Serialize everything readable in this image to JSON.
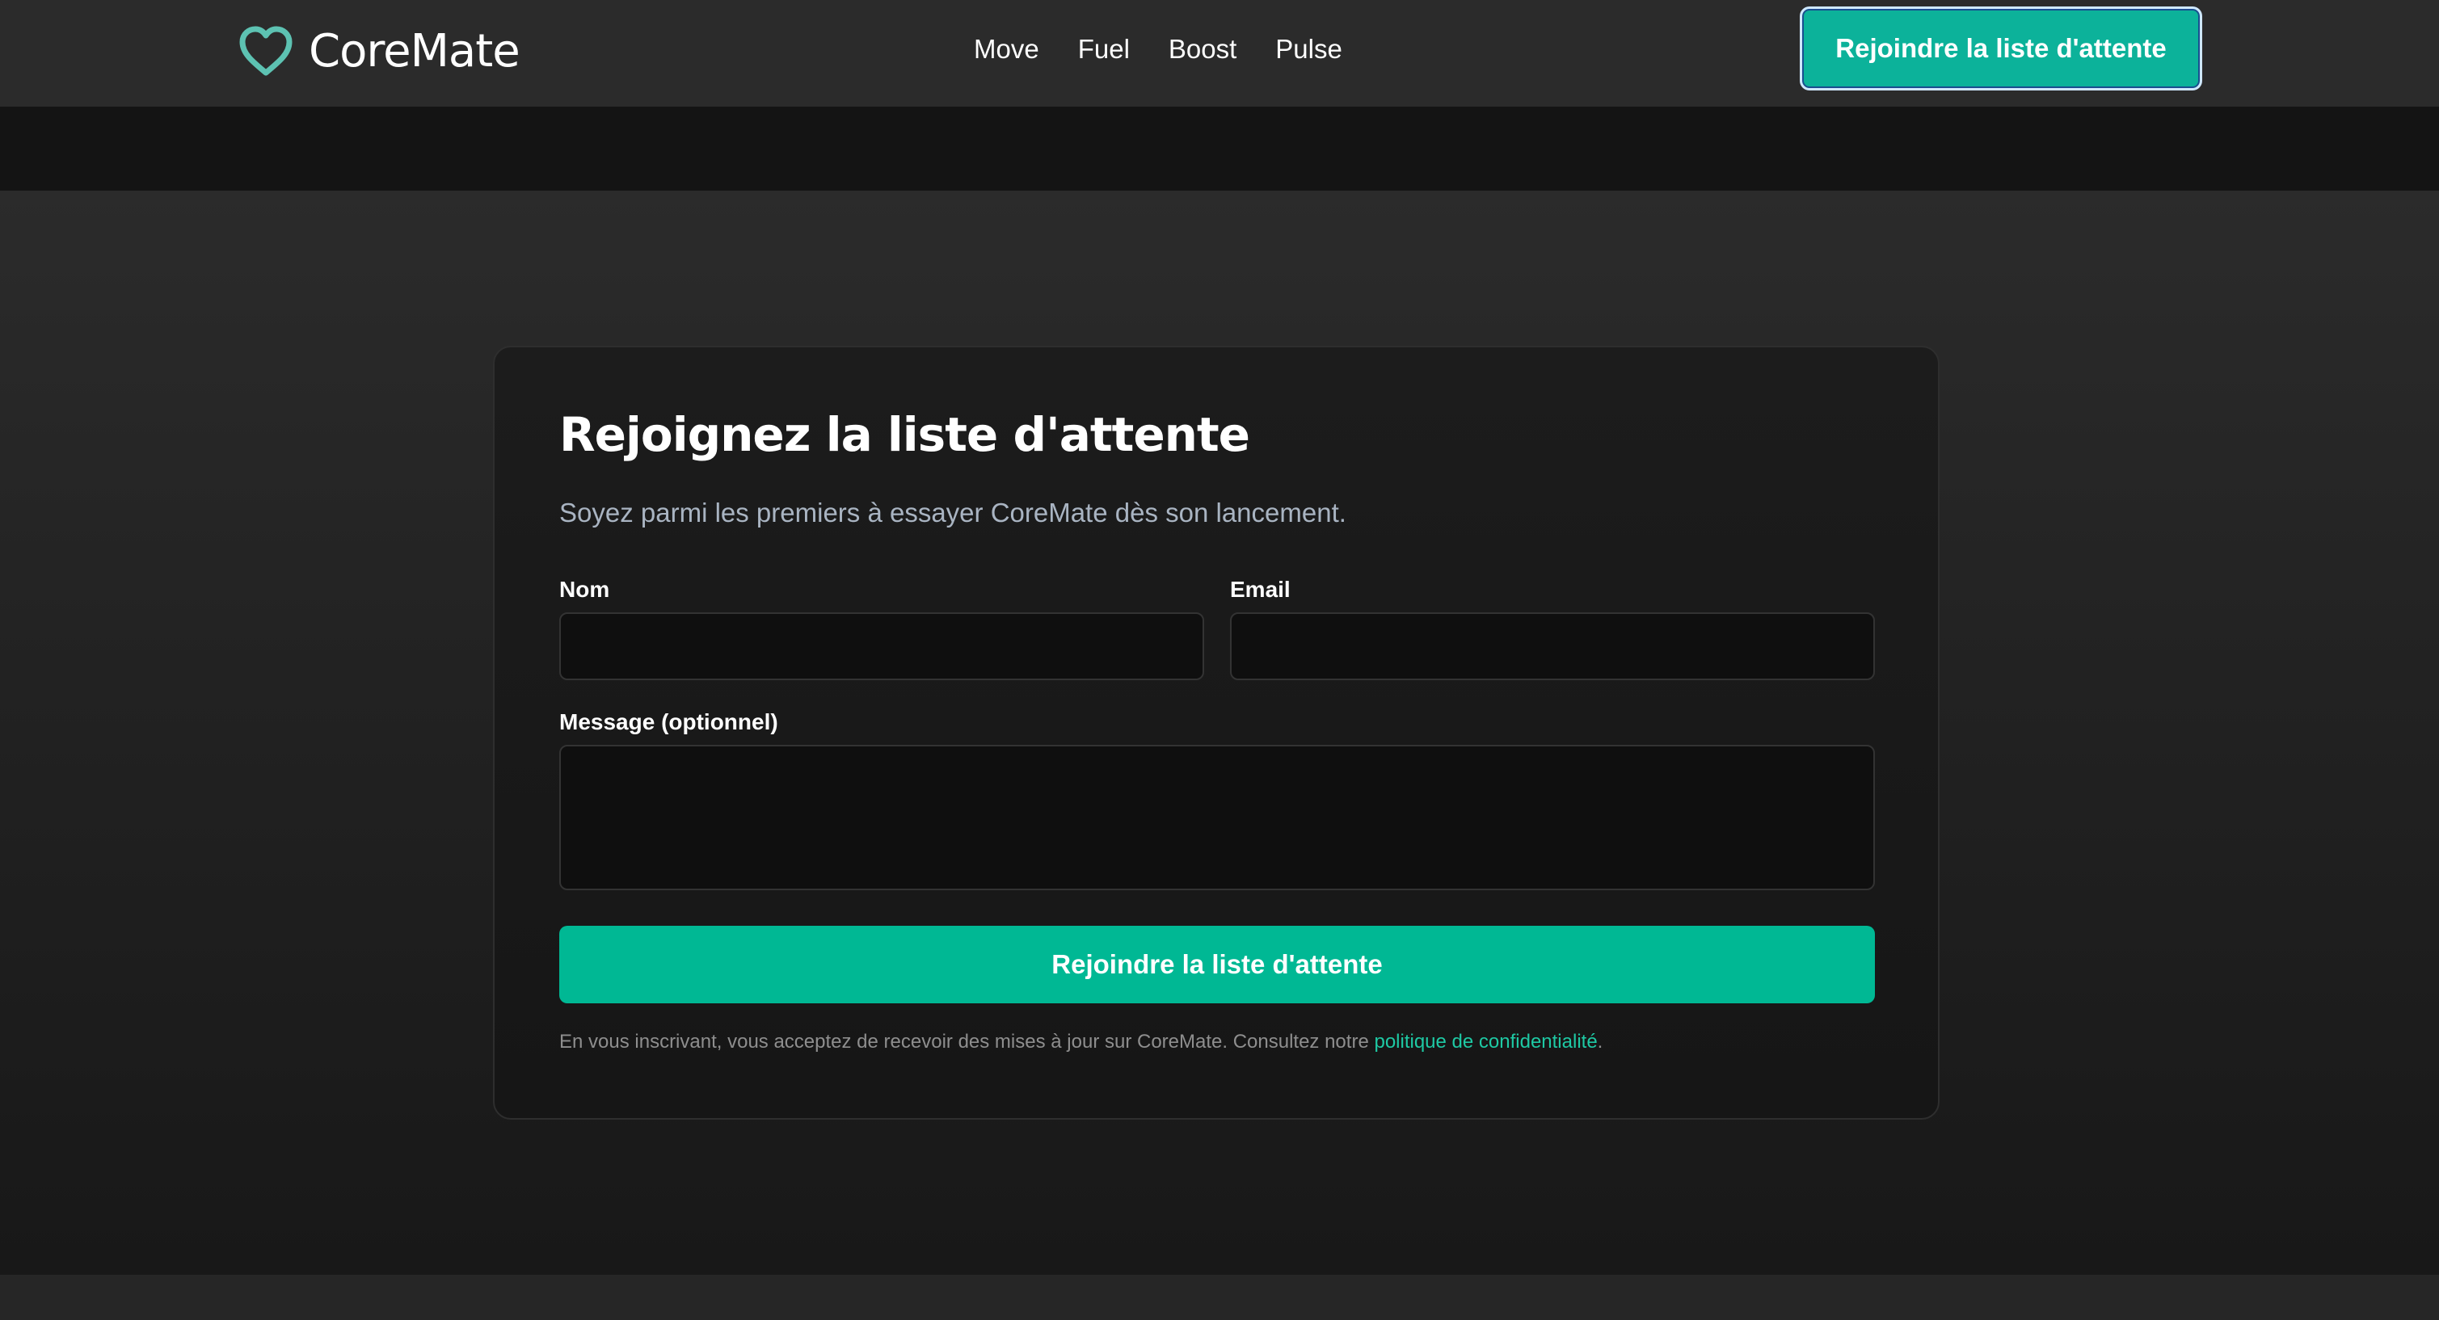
{
  "header": {
    "logo_text": "CoreMate",
    "nav": [
      {
        "label": "Move"
      },
      {
        "label": "Fuel"
      },
      {
        "label": "Boost"
      },
      {
        "label": "Pulse"
      }
    ],
    "cta_label": "Rejoindre la liste d'attente"
  },
  "form": {
    "title": "Rejoignez la liste d'attente",
    "subtitle": "Soyez parmi les premiers à essayer CoreMate dès son lancement.",
    "name_label": "Nom",
    "name_value": "",
    "email_label": "Email",
    "email_value": "",
    "message_label": "Message (optionnel)",
    "message_value": "",
    "submit_label": "Rejoindre la liste d'attente",
    "disclaimer_text": "En vous inscrivant, vous acceptez de recevoir des mises à jour sur CoreMate. Consultez notre ",
    "disclaimer_link": "politique de confidentialité",
    "disclaimer_end": "."
  },
  "colors": {
    "accent": "#00b894",
    "header_bg": "#2b2b2b",
    "card_bg": "#1a1a1a"
  },
  "icons": {
    "logo": "heart-outline-icon"
  }
}
